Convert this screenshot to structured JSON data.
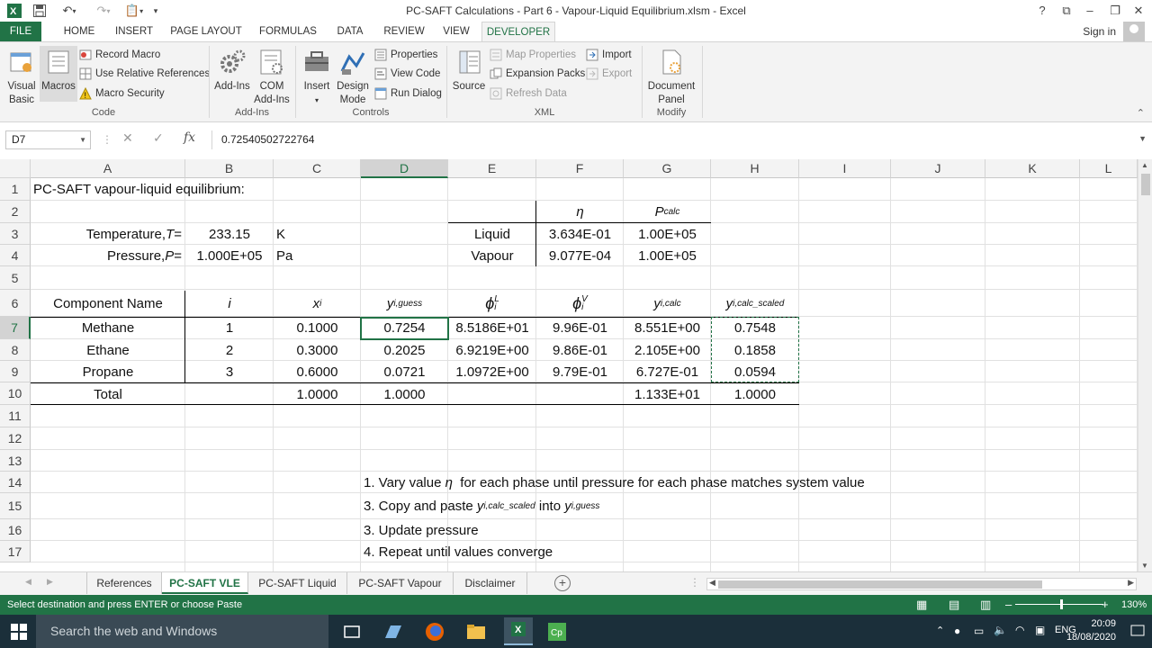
{
  "window": {
    "title": "PC-SAFT Calculations - Part 6 - Vapour-Liquid Equilibrium.xlsm - Excel",
    "help": "?",
    "minimize": "–",
    "restore": "❐",
    "close": "✕"
  },
  "ribbon_tabs": [
    "FILE",
    "HOME",
    "INSERT",
    "PAGE LAYOUT",
    "FORMULAS",
    "DATA",
    "REVIEW",
    "VIEW",
    "DEVELOPER"
  ],
  "account": {
    "sign_in": "Sign in"
  },
  "ribbon": {
    "code": {
      "label": "Code",
      "visual_basic": "Visual Basic",
      "macros": "Macros",
      "record_macro": "Record Macro",
      "relative_refs": "Use Relative References",
      "macro_security": "Macro Security"
    },
    "addins": {
      "label": "Add-Ins",
      "add_ins": "Add-Ins",
      "com_add_ins": "COM Add-Ins"
    },
    "controls": {
      "label": "Controls",
      "insert": "Insert",
      "design_mode": "Design Mode",
      "properties": "Properties",
      "view_code": "View Code",
      "run_dialog": "Run Dialog"
    },
    "xml": {
      "label": "XML",
      "source": "Source",
      "map_properties": "Map Properties",
      "expansion_packs": "Expansion Packs",
      "refresh_data": "Refresh Data",
      "import": "Import",
      "export": "Export"
    },
    "modify": {
      "label": "Modify",
      "document_panel": "Document Panel"
    }
  },
  "formula_bar": {
    "name_box": "D7",
    "fx": "fx",
    "value": "0.72540502722764"
  },
  "columns": [
    "A",
    "B",
    "C",
    "D",
    "E",
    "F",
    "G",
    "H",
    "I",
    "J",
    "K",
    "L"
  ],
  "rows": [
    "1",
    "2",
    "3",
    "4",
    "5",
    "6",
    "7",
    "8",
    "9",
    "10",
    "11",
    "12",
    "13",
    "14",
    "15",
    "16",
    "17"
  ],
  "sheet": {
    "title": "PC-SAFT vapour-liquid equilibrium:",
    "temperature": {
      "label": "Temperature, ",
      "symbol": "T",
      "eq": " =",
      "value": "233.15",
      "unit": "K"
    },
    "pressure": {
      "label": "Pressure, ",
      "symbol": "P",
      "eq": " =",
      "value": "1.000E+05",
      "unit": "Pa"
    },
    "phase_table": {
      "eta": "η",
      "pcalc": "P",
      "pcalc_sub": "calc",
      "rows": [
        {
          "phase": "Liquid",
          "eta": "3.634E-01",
          "p": "1.00E+05"
        },
        {
          "phase": "Vapour",
          "eta": "9.077E-04",
          "p": "1.00E+05"
        }
      ]
    },
    "comp_table": {
      "h_name": "Component Name",
      "h_i": "i",
      "h_x": "x",
      "h_x_sub": "i",
      "h_yg": "y",
      "h_yg_sub": "i,guess",
      "h_phiL": "ϕ",
      "h_phiL_sub": "i",
      "h_phiL_sup": "L",
      "h_phiV": "ϕ",
      "h_phiV_sub": "i",
      "h_phiV_sup": "V",
      "h_yc": "y",
      "h_yc_sub": "i,calc",
      "h_ys": "y",
      "h_ys_sub": "i,calc_scaled",
      "rows": [
        {
          "name": "Methane",
          "i": "1",
          "x": "0.1000",
          "yg": "0.7254",
          "phiL": "8.5186E+01",
          "phiV": "9.96E-01",
          "yc": "8.551E+00",
          "ys": "0.7548"
        },
        {
          "name": "Ethane",
          "i": "2",
          "x": "0.3000",
          "yg": "0.2025",
          "phiL": "6.9219E+00",
          "phiV": "9.86E-01",
          "yc": "2.105E+00",
          "ys": "0.1858"
        },
        {
          "name": "Propane",
          "i": "3",
          "x": "0.6000",
          "yg": "0.0721",
          "phiL": "1.0972E+00",
          "phiV": "9.79E-01",
          "yc": "6.727E-01",
          "ys": "0.0594"
        }
      ],
      "total": {
        "label": "Total",
        "x": "1.0000",
        "yg": "1.0000",
        "yc": "1.133E+01",
        "ys": "1.0000"
      }
    },
    "notes": {
      "n1_a": "1. Vary value ",
      "n1_sym": "η",
      "n1_b": "  for each phase until pressure for each phase matches system value",
      "n2_a": "3. Copy and paste ",
      "n2_y1": "y",
      "n2_sub1": "i,calc_scaled",
      "n2_b": " into ",
      "n2_y2": "y",
      "n2_sub2": "i,guess",
      "n3": "3. Update pressure",
      "n4": "4. Repeat until values converge"
    }
  },
  "sheet_tabs": [
    "References",
    "PC-SAFT VLE",
    "PC-SAFT Liquid",
    "PC-SAFT Vapour",
    "Disclaimer"
  ],
  "active_sheet": "PC-SAFT VLE",
  "status": {
    "message": "Select destination and press ENTER or choose Paste",
    "zoom": "130%"
  },
  "taskbar": {
    "search": "Search the web and Windows",
    "lang": "ENG",
    "time": "20:09",
    "date": "18/08/2020"
  },
  "colors": {
    "excel_green": "#217346",
    "taskbar": "#1b2f3a"
  }
}
